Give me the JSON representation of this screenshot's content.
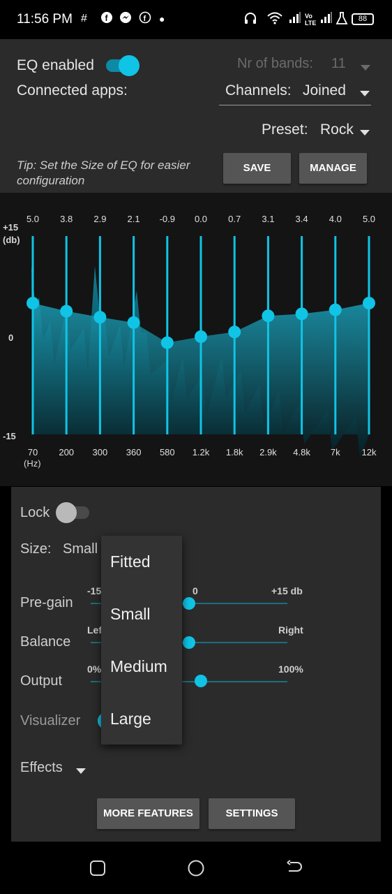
{
  "status_bar": {
    "time": "11:56 PM",
    "battery": "88",
    "icons": [
      "hash-icon",
      "facebook-icon",
      "messenger-icon",
      "facebook-icon",
      "dot-icon",
      "headphones-icon",
      "wifi-icon",
      "signal-icon",
      "volte-icon",
      "signal-icon",
      "flask-icon"
    ]
  },
  "settings": {
    "eq_enabled_label": "EQ enabled",
    "eq_enabled": true,
    "nr_bands_label": "Nr of bands:",
    "nr_bands_value": "11",
    "connected_apps_label": "Connected apps:",
    "channels_label": "Channels:",
    "channels_value": "Joined",
    "preset_label": "Preset:",
    "preset_value": "Rock",
    "tip": "Tip: Set the Size of EQ for easier configuration",
    "save_label": "SAVE",
    "manage_label": "MANAGE"
  },
  "eq": {
    "y_top_label": "+15",
    "y_top_unit": "(db)",
    "y_mid_label": "0",
    "y_bottom_label": "-15",
    "x_unit": "(Hz)",
    "gains": [
      "5.0",
      "3.8",
      "2.9",
      "2.1",
      "-0.9",
      "0.0",
      "0.7",
      "3.1",
      "3.4",
      "4.0",
      "5.0"
    ],
    "gain_values": [
      5.0,
      3.8,
      2.9,
      2.1,
      -0.9,
      0.0,
      0.7,
      3.1,
      3.4,
      4.0,
      5.0
    ],
    "freqs": [
      "70",
      "200",
      "300",
      "360",
      "580",
      "1.2k",
      "1.8k",
      "2.9k",
      "4.8k",
      "7k",
      "12k"
    ],
    "accent": "#10c4e6"
  },
  "controls": {
    "lock_label": "Lock",
    "lock_on": false,
    "size_label": "Size:",
    "size_value": "Small",
    "pregain_label": "Pre-gain",
    "pregain_min": "-15",
    "pregain_mid": "0",
    "pregain_max": "+15 db",
    "pregain_value_db": 0,
    "balance_label": "Balance",
    "balance_left": "Left",
    "balance_right": "Right",
    "balance_value": 0,
    "output_label": "Output",
    "output_min": "0%",
    "output_max": "100%",
    "output_value_pct": 56,
    "visualizer_label": "Visualizer",
    "effects_label": "Effects",
    "more_features_label": "MORE FEATURES",
    "settings_label": "SETTINGS"
  },
  "size_menu": {
    "options": [
      "Fitted",
      "Small",
      "Medium",
      "Large"
    ]
  }
}
